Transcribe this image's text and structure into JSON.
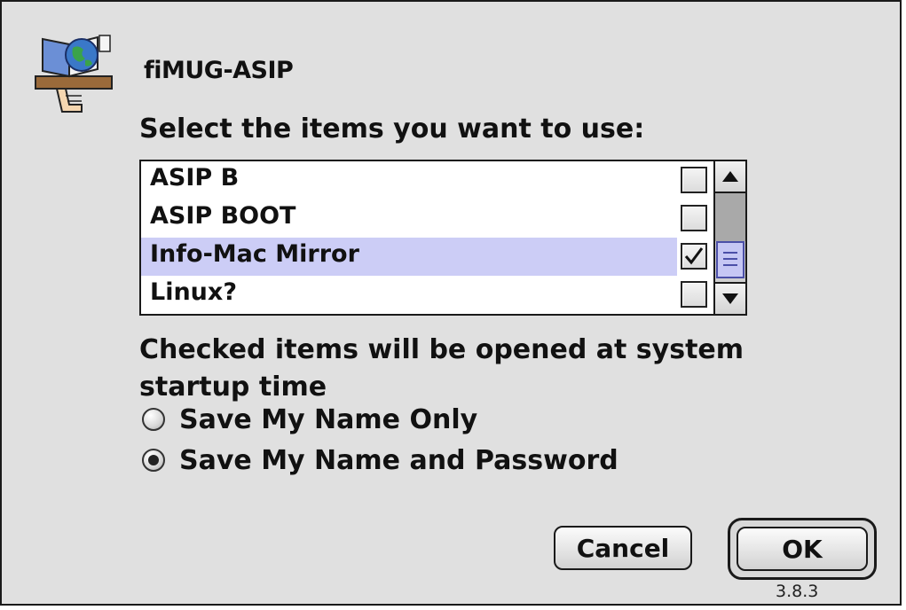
{
  "dialog": {
    "server_name": "fiMUG-ASIP",
    "prompt": "Select the items you want to use:",
    "note": "Checked items will be opened at system startup time",
    "version": "3.8.3"
  },
  "volumes": {
    "items": [
      {
        "label": "ASIP B",
        "checked": false,
        "selected": false
      },
      {
        "label": "ASIP BOOT",
        "checked": false,
        "selected": false
      },
      {
        "label": "Info-Mac Mirror",
        "checked": true,
        "selected": true
      },
      {
        "label": "Linux?",
        "checked": false,
        "selected": false
      }
    ]
  },
  "options": {
    "radios": [
      {
        "label": "Save My Name Only",
        "checked": false
      },
      {
        "label": "Save My Name and Password",
        "checked": true
      }
    ]
  },
  "buttons": {
    "cancel": "Cancel",
    "ok": "OK"
  },
  "icons": {
    "app": "appleshare-globe-icon",
    "scroll_up": "up-arrow-icon",
    "scroll_down": "down-arrow-icon",
    "check": "checkmark-icon"
  },
  "colors": {
    "dialog_bg": "#e0e0e0",
    "selection": "#cccdf6",
    "scroll_thumb": "#c6c7f4"
  }
}
